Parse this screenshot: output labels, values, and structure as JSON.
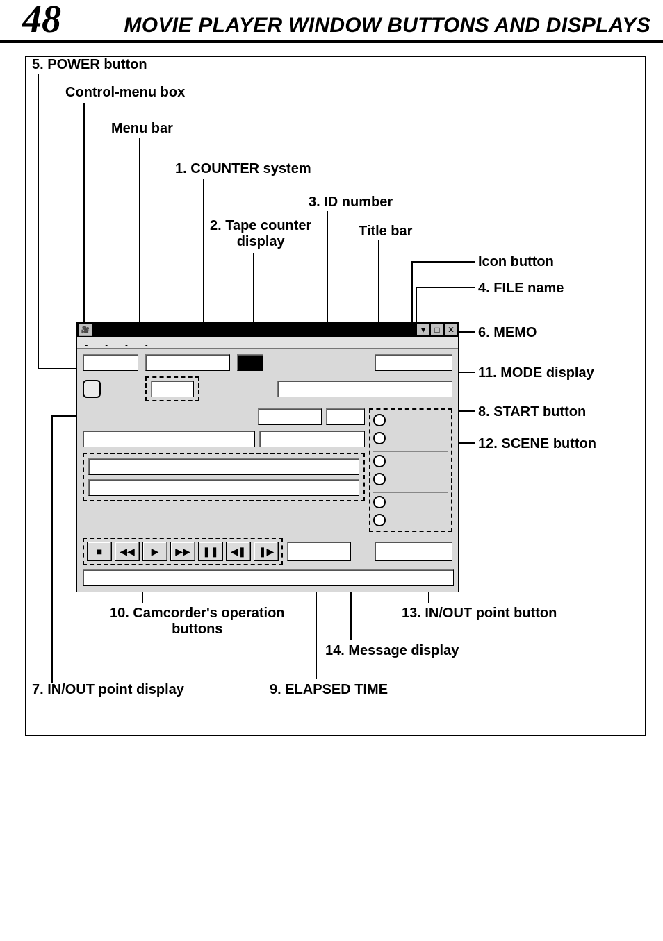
{
  "page_number": "48",
  "header_title": "MOVIE PLAYER WINDOW BUTTONS AND DISPLAYS",
  "labels": {
    "power": "5. POWER button",
    "control_menu": "Control-menu box",
    "menu_bar": "Menu bar",
    "counter_system": "1. COUNTER system",
    "id_number": "3. ID number",
    "tape_counter": "2. Tape counter\ndisplay",
    "title_bar": "Title bar",
    "icon_button": "Icon button",
    "file_name": "4. FILE name",
    "memo": "6. MEMO",
    "mode_display": "11. MODE display",
    "start_button": "8. START button",
    "scene_button": "12. SCENE button",
    "camcorder_ops": "10. Camcorder's operation\nbuttons",
    "inout_button": "13. IN/OUT point button",
    "message_display": "14. Message display",
    "inout_display": "7. IN/OUT point display",
    "elapsed_time": "9. ELAPSED TIME"
  },
  "icons": {
    "stop": "■",
    "rewind": "◀◀",
    "play": "▶",
    "ffwd": "▶▶",
    "pause": "❚❚",
    "stepback": "◀❚",
    "stepfwd": "❚▶",
    "close": "✕",
    "max": "□",
    "min": "▾"
  }
}
